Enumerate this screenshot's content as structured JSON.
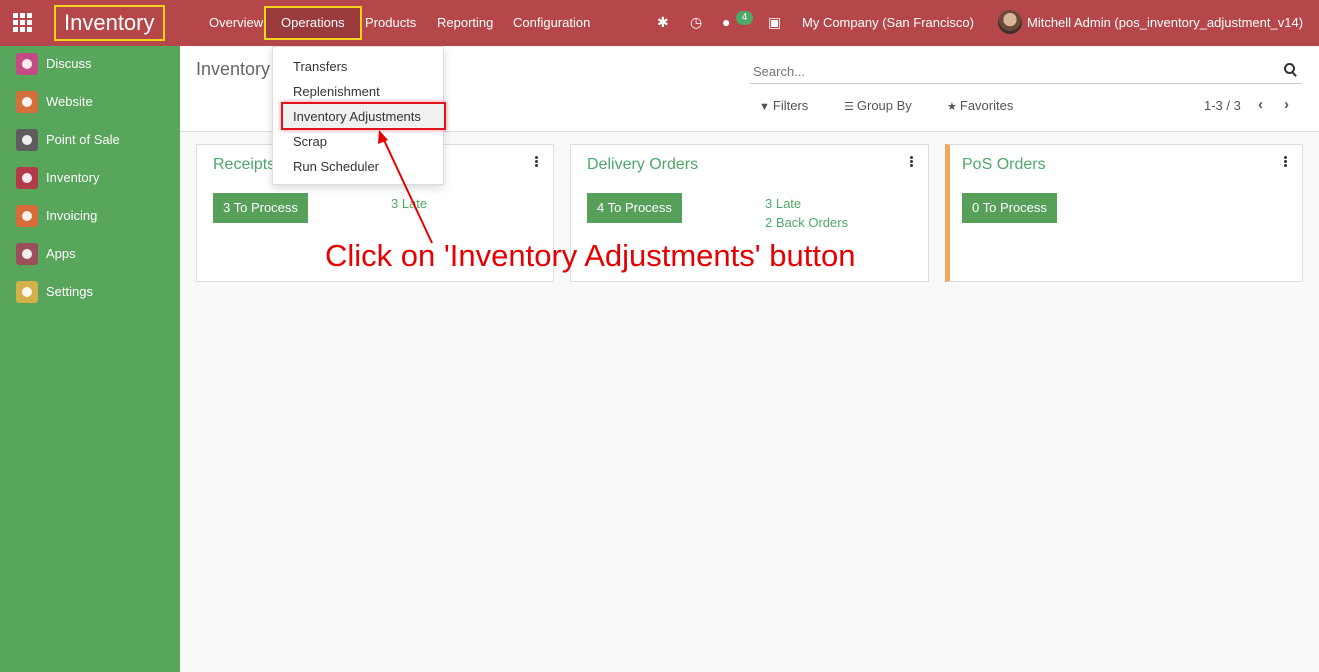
{
  "navbar": {
    "brand": "Inventory",
    "menu": [
      "Overview",
      "Operations",
      "Products",
      "Reporting",
      "Configuration"
    ],
    "messages_badge": "4",
    "company": "My Company (San Francisco)",
    "user": "Mitchell Admin (pos_inventory_adjustment_v14)"
  },
  "sidebar": {
    "items": [
      {
        "label": "Discuss",
        "color": "#c34a82"
      },
      {
        "label": "Website",
        "color": "#d4703b"
      },
      {
        "label": "Point of Sale",
        "color": "#5d5d5d"
      },
      {
        "label": "Inventory",
        "color": "#b23b4a"
      },
      {
        "label": "Invoicing",
        "color": "#d86b38"
      },
      {
        "label": "Apps",
        "color": "#9b4f5c"
      },
      {
        "label": "Settings",
        "color": "#d4b04a"
      }
    ]
  },
  "control_panel": {
    "breadcrumb": "Inventory",
    "search_placeholder": "Search...",
    "filters": "Filters",
    "group_by": "Group By",
    "favorites": "Favorites",
    "pager": "1-3 / 3"
  },
  "dropdown": {
    "items": [
      "Transfers",
      "Replenishment",
      "Inventory Adjustments",
      "Scrap",
      "Run Scheduler"
    ]
  },
  "cards": [
    {
      "title": "Receipts",
      "button": "3 To Process",
      "links": [
        "3 Late"
      ]
    },
    {
      "title": "Delivery Orders",
      "button": "4 To Process",
      "links": [
        "3 Late",
        "2 Back Orders"
      ]
    },
    {
      "title": "PoS Orders",
      "button": "0 To Process",
      "links": []
    }
  ],
  "annotation": "Click on 'Inventory Adjustments' button",
  "colors": {
    "navbar": "#b5474a",
    "sidebar": "#58a55c",
    "accent": "#4fa868",
    "highlight": "#f3d21b",
    "annotation": "#e60000"
  }
}
